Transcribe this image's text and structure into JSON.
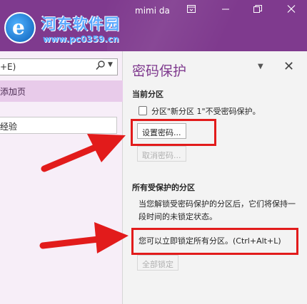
{
  "titlebar": {
    "user": "mimi da",
    "icons": [
      "ribbon-display-icon",
      "minimize-icon",
      "restore-icon",
      "close-icon"
    ],
    "accent": "#7f3a8e"
  },
  "watermark": {
    "logo_letter": "e",
    "title": "河东软件园",
    "url": "www.pc0359.cn"
  },
  "left_pane": {
    "search_text": "+E)",
    "add_page": "添加页",
    "page_item": "经验"
  },
  "right_pane": {
    "title": "密码保护",
    "current_section_heading": "当前分区",
    "status": "分区\"新分区 1\"不受密码保护。",
    "set_password_button": "设置密码...",
    "remove_password_button": "取消密码...",
    "protected_heading": "所有受保护的分区",
    "description": "当您解锁受密码保护的分区后，它们将保持一段时间的未锁定状态。",
    "lock_all_hint": "您可以立即锁定所有分区。(Ctrl+Alt+L)",
    "lock_all_button": "全部锁定"
  },
  "colors": {
    "annotation_red": "#e21b1b",
    "left_highlight": "#e8cbea",
    "watermark_blue": "#5aa8ff"
  }
}
